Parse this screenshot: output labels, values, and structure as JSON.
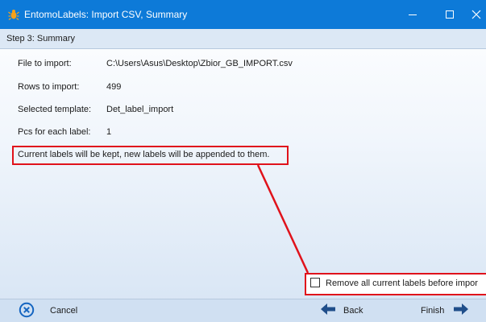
{
  "window": {
    "title": "EntomoLabels: Import CSV, Summary",
    "icons": {
      "app": "bug-icon",
      "minimize": "minimize-icon",
      "maximize": "maximize-icon",
      "close": "close-icon"
    },
    "title_bar_color": "#0d7ad8"
  },
  "step": {
    "label": "Step 3: Summary"
  },
  "summary": {
    "file_label": "File to import:",
    "file_value": "C:\\Users\\Asus\\Desktop\\Zbior_GB_IMPORT.csv",
    "rows_label": "Rows to import:",
    "rows_value": "499",
    "template_label": "Selected template:",
    "template_value": "Det_label_import",
    "pcs_label": "Pcs for each label:",
    "pcs_value": "1"
  },
  "message": "Current labels will be kept, new labels will be appended to them.",
  "option": {
    "label": "Remove all current labels before impor",
    "checked": false
  },
  "footer": {
    "cancel_label": "Cancel",
    "back_label": "Back",
    "finish_label": "Finish",
    "icons": {
      "cancel": "cancel-circle-icon",
      "back": "arrow-left-icon",
      "finish": "arrow-right-icon"
    }
  },
  "highlight_color": "#e0121b"
}
